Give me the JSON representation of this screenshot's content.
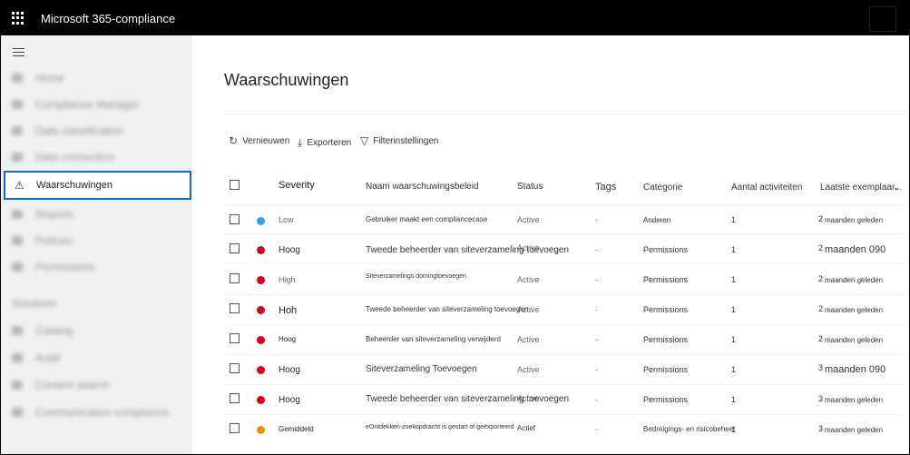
{
  "app": {
    "title": "Microsoft 365-compliance"
  },
  "nav": {
    "blurred_items": [
      "Home",
      "Compliance Manager",
      "Data classification",
      "Data connectors",
      "",
      "Reports",
      "Policies",
      "Permissions",
      "",
      "Catalog",
      "Audit",
      "Content search",
      "Communication compliance"
    ],
    "section_label": "Solutions",
    "active_item": "Waarschuwingen"
  },
  "page": {
    "title": "Waarschuwingen"
  },
  "toolbar": {
    "refresh": "Vernieuwen",
    "export": "Exporteren",
    "filter": "Filterinstellingen"
  },
  "table": {
    "headers": {
      "severity": "Severity",
      "policy": "Naam waarschuwingsbeleid",
      "status": "Status",
      "tags": "Tags",
      "category": "Categorie",
      "activities": "Aantal activiteiten",
      "last": "Laatste exemplaar..."
    },
    "rows": [
      {
        "severity": "Low",
        "color": "#29a8e0",
        "policy": "Gebruiker maakt een compliancecase",
        "status": "Active",
        "tags": "-",
        "category": "Anderen",
        "activities": "1",
        "last_num": "2",
        "last_text": "maanden geleden"
      },
      {
        "severity": "Hoog",
        "color": "#d6001c",
        "policy": "Tweede beheerder van siteverzameling toevoegen",
        "status": "Active",
        "tags": "-",
        "category": "Permissions",
        "activities": "1",
        "last_num": "2",
        "last_text": "maanden 090"
      },
      {
        "severity": "High",
        "color": "#d6001c",
        "policy": "Siteverzamelings domingtoevoegen",
        "status": "Active",
        "tags": "-",
        "category": "Permissions",
        "activities": "1",
        "last_num": "2",
        "last_text": "maanden geleden"
      },
      {
        "severity": "Hoh",
        "color": "#d6001c",
        "policy": "Tweede beheerder van siteverzameling toevoegen",
        "status": "Active",
        "tags": "-",
        "category": "Permissions",
        "activities": "1",
        "last_num": "2",
        "last_text": "maanden geleden"
      },
      {
        "severity": "Hoog",
        "color": "#d6001c",
        "policy": "Beheerder van siteverzameling verwijderd",
        "status": "Active",
        "tags": "-",
        "category": "Permissions",
        "activities": "1",
        "last_num": "2",
        "last_text": "maanden geleden"
      },
      {
        "severity": "Hoog",
        "color": "#d6001c",
        "policy": "Siteverzameling Toevoegen",
        "status": "Active",
        "tags": "-",
        "category": "Permissions",
        "activities": "1",
        "last_num": "3",
        "last_text": "maanden 090"
      },
      {
        "severity": "Hoog",
        "color": "#d6001c",
        "policy": "Tweede beheerder van siteverzameling toevoegen",
        "status": "Active",
        "tags": "-",
        "category": "Permissions",
        "activities": "1",
        "last_num": "3",
        "last_text": "maanden geleden"
      },
      {
        "severity": "Gemiddeld",
        "color": "#f28c00",
        "policy": "eOntdekken-zoekopdracht is gestart of geëxporteerd",
        "status": "Actief",
        "tags": "-",
        "category": "Bedreigings- en risicobeheer",
        "activities": "1",
        "last_num": "3",
        "last_text": "maanden geleden"
      }
    ]
  }
}
